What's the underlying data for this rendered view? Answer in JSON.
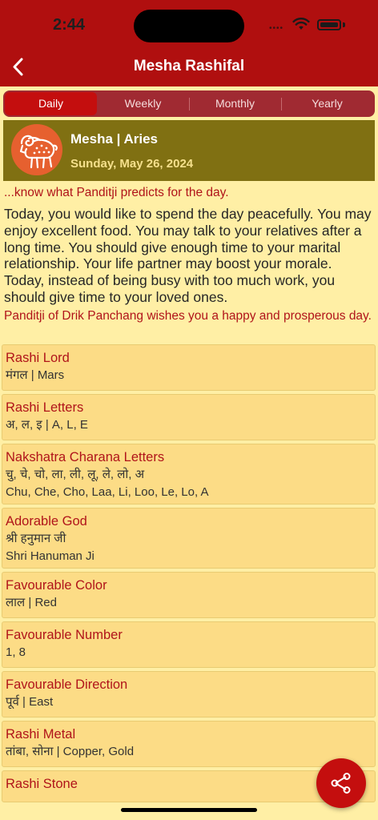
{
  "status": {
    "time": "2:44"
  },
  "nav": {
    "title": "Mesha Rashifal"
  },
  "tabs": [
    {
      "label": "Daily",
      "active": true
    },
    {
      "label": "Weekly",
      "active": false
    },
    {
      "label": "Monthly",
      "active": false
    },
    {
      "label": "Yearly",
      "active": false
    }
  ],
  "sign": {
    "name": "Mesha | Aries",
    "date": "Sunday, May 26, 2024"
  },
  "intro": "...know what Panditji predicts for the day.",
  "prediction": "Today, you would like to spend the day peacefully. You may enjoy excellent food. You may talk to your relatives after a long time. You should give enough time to your marital relationship. Your life partner may boost your morale. Today, instead of being busy with too much work, you should give time to your loved ones.",
  "wishes": "Panditji of Drik Panchang wishes you a happy and prosperous day.",
  "info": [
    {
      "title": "Rashi Lord",
      "lines": [
        "मंगल | Mars"
      ]
    },
    {
      "title": "Rashi Letters",
      "lines": [
        "अ, ल, इ | A, L, E"
      ]
    },
    {
      "title": "Nakshatra Charana Letters",
      "lines": [
        "चु, चे, चो, ला, ली, लू, ले, लो, अ",
        "Chu, Che, Cho, Laa, Li, Loo, Le, Lo, A"
      ]
    },
    {
      "title": "Adorable God",
      "lines": [
        "श्री हनुमान जी",
        "Shri Hanuman Ji"
      ]
    },
    {
      "title": "Favourable Color",
      "lines": [
        "लाल | Red"
      ]
    },
    {
      "title": "Favourable Number",
      "lines": [
        "1, 8"
      ]
    },
    {
      "title": "Favourable Direction",
      "lines": [
        "पूर्व | East"
      ]
    },
    {
      "title": "Rashi Metal",
      "lines": [
        "तांबा, सोना | Copper, Gold"
      ]
    },
    {
      "title": "Rashi Stone",
      "lines": []
    }
  ],
  "icons": {
    "back": "chevron-left-icon",
    "share": "share-icon",
    "sign": "aries-ram-icon"
  },
  "colors": {
    "primary": "#B00F0F",
    "background": "#FFEFA5",
    "card": "#FCDC86",
    "accent_text": "#B0141A",
    "sign_card": "#807012"
  }
}
